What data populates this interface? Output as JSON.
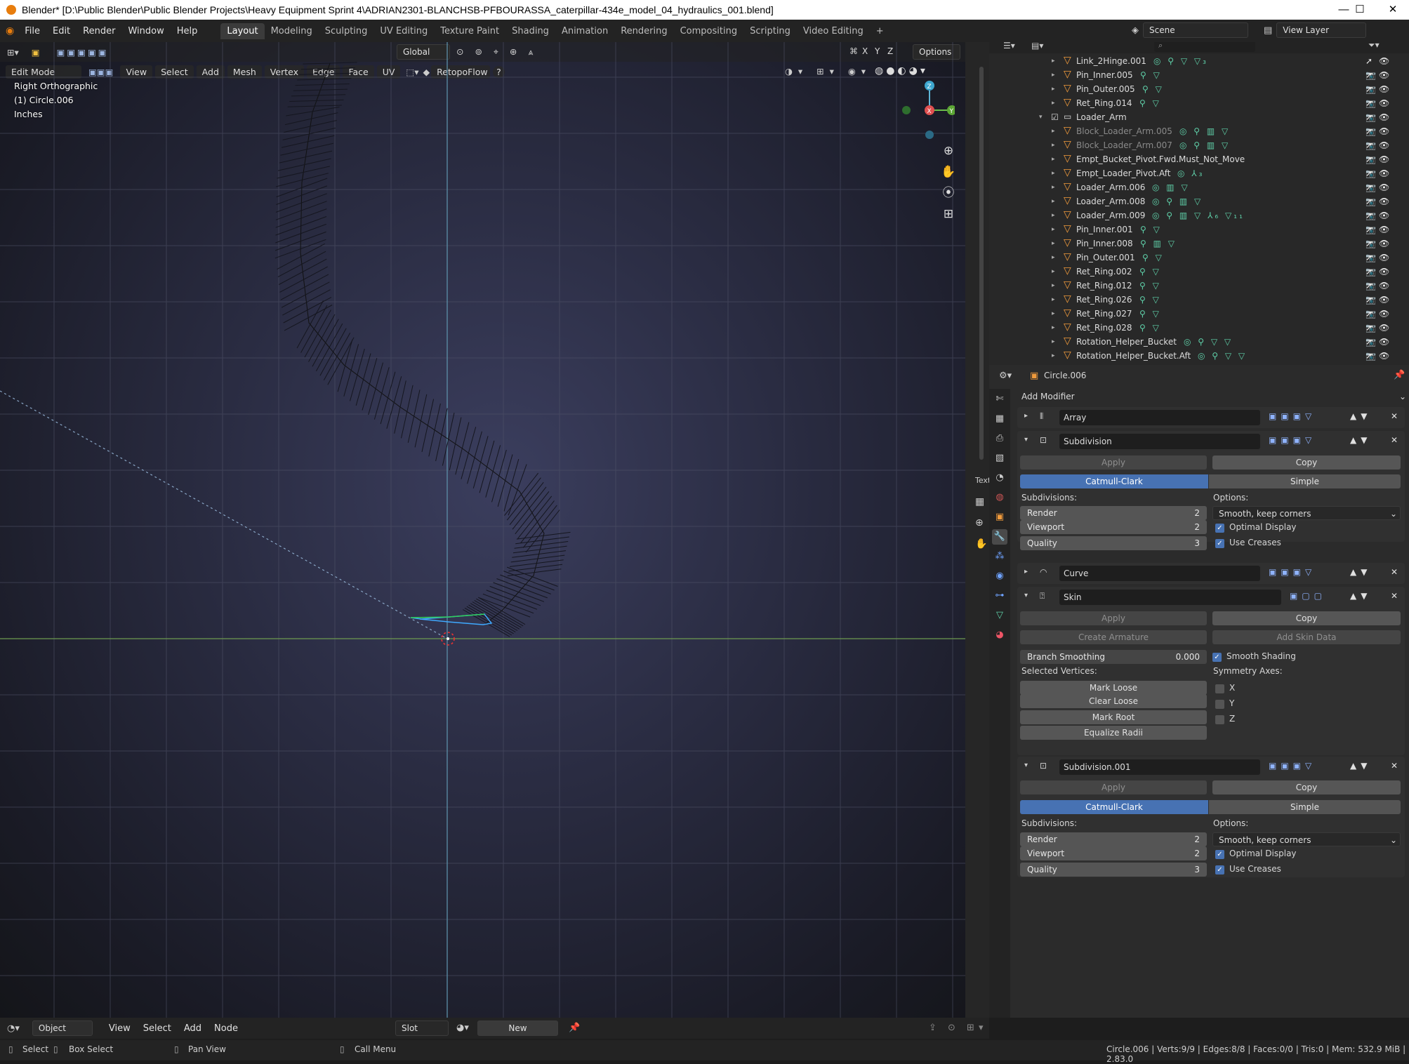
{
  "window": {
    "title": "Blender* [D:\\Public Blender\\Public Blender Projects\\Heavy Equipment Sprint 4\\ADRIAN2301-BLANCHSB-PFBOURASSA_caterpillar-434e_model_04_hydraulics_001.blend]",
    "minimize": "—",
    "maximize": "☐",
    "close": "✕"
  },
  "menus": [
    "File",
    "Edit",
    "Render",
    "Window",
    "Help"
  ],
  "workspaces": [
    "Layout",
    "Modeling",
    "Sculpting",
    "UV Editing",
    "Texture Paint",
    "Shading",
    "Animation",
    "Rendering",
    "Compositing",
    "Scripting",
    "Video Editing"
  ],
  "add_workspace": "+",
  "scene": {
    "value": "Scene",
    "view_layer": "View Layer"
  },
  "viewport_header": {
    "transform_orientation": "Global",
    "options": "Options",
    "axes": [
      "X",
      "Y",
      "Z"
    ],
    "mode": "Edit Mode",
    "menus": [
      "View",
      "Select",
      "Add",
      "Mesh",
      "Vertex",
      "Edge",
      "Face",
      "UV"
    ],
    "addon": "RetopoFlow",
    "help": "?"
  },
  "viewport_overlay": {
    "view": "Right Orthographic",
    "object": "(1) Circle.006",
    "units": "Inches"
  },
  "gizmo": {
    "x": "X",
    "y": "Y",
    "z": "Z"
  },
  "side_tab": "Text",
  "outliner": {
    "search_placeholder": "",
    "rows": [
      {
        "name": "Link_2Hinge.001",
        "icons": "◎ ⚲ ▽ ▽₃",
        "dim": false
      },
      {
        "name": "Pin_Inner.005",
        "icons": "⚲ ▽",
        "dim": false
      },
      {
        "name": "Pin_Outer.005",
        "icons": "⚲ ▽",
        "dim": false
      },
      {
        "name": "Ret_Ring.014",
        "icons": "⚲ ▽",
        "dim": false
      },
      {
        "name": "Loader_Arm",
        "icons": "",
        "dim": false,
        "collection": true
      },
      {
        "name": "Block_Loader_Arm.005",
        "icons": "◎ ⚲ ▥ ▽",
        "dim": true
      },
      {
        "name": "Block_Loader_Arm.007",
        "icons": "◎ ⚲ ▥ ▽",
        "dim": true
      },
      {
        "name": "Empt_Bucket_Pivot.Fwd.Must_Not_Move",
        "icons": "",
        "dim": false
      },
      {
        "name": "Empt_Loader_Pivot.Aft",
        "icons": "◎ ⅄₃",
        "dim": false
      },
      {
        "name": "Loader_Arm.006",
        "icons": "◎ ▥ ▽",
        "dim": false
      },
      {
        "name": "Loader_Arm.008",
        "icons": "◎ ⚲ ▥ ▽",
        "dim": false
      },
      {
        "name": "Loader_Arm.009",
        "icons": "◎ ⚲ ▥ ▽ ⅄₆ ▽₁₁",
        "dim": false
      },
      {
        "name": "Pin_Inner.001",
        "icons": "⚲ ▽",
        "dim": false
      },
      {
        "name": "Pin_Inner.008",
        "icons": "⚲ ▥ ▽",
        "dim": false
      },
      {
        "name": "Pin_Outer.001",
        "icons": "⚲ ▽",
        "dim": false
      },
      {
        "name": "Ret_Ring.002",
        "icons": "⚲ ▽",
        "dim": false
      },
      {
        "name": "Ret_Ring.012",
        "icons": "⚲ ▽",
        "dim": false
      },
      {
        "name": "Ret_Ring.026",
        "icons": "⚲ ▽",
        "dim": false
      },
      {
        "name": "Ret_Ring.027",
        "icons": "⚲ ▽",
        "dim": false
      },
      {
        "name": "Ret_Ring.028",
        "icons": "⚲ ▽",
        "dim": false
      },
      {
        "name": "Rotation_Helper_Bucket",
        "icons": "◎ ⚲ ▽ ▽",
        "dim": false
      },
      {
        "name": "Rotation_Helper_Bucket.Aft",
        "icons": "◎ ⚲ ▽ ▽",
        "dim": false
      }
    ]
  },
  "properties": {
    "object": "Circle.006",
    "add_modifier": "Add Modifier",
    "array": {
      "name": "Array"
    },
    "subdivision": {
      "name": "Subdivision",
      "apply": "Apply",
      "copy": "Copy",
      "catmull": "Catmull-Clark",
      "simple": "Simple",
      "subdivisions": "Subdivisions:",
      "options": "Options:",
      "render_label": "Render",
      "render": "2",
      "viewport_label": "Viewport",
      "viewport": "2",
      "quality_label": "Quality",
      "quality": "3",
      "uv_smooth": "Smooth, keep corners",
      "optimal": "Optimal Display",
      "creases": "Use Creases"
    },
    "curve": {
      "name": "Curve"
    },
    "skin": {
      "name": "Skin",
      "apply": "Apply",
      "copy": "Copy",
      "create_armature": "Create Armature",
      "add_skin_data": "Add Skin Data",
      "branch_label": "Branch Smoothing",
      "branch": "0.000",
      "smooth_shading": "Smooth Shading",
      "selected_vertices": "Selected Vertices:",
      "symmetry_axes": "Symmetry Axes:",
      "mark_loose": "Mark Loose",
      "clear_loose": "Clear Loose",
      "mark_root": "Mark Root",
      "equalize": "Equalize Radii",
      "x": "X",
      "y": "Y",
      "z": "Z"
    },
    "subdivision2": {
      "name": "Subdivision.001",
      "apply": "Apply",
      "copy": "Copy",
      "catmull": "Catmull-Clark",
      "simple": "Simple",
      "subdivisions": "Subdivisions:",
      "options": "Options:",
      "render_label": "Render",
      "render": "2",
      "viewport_label": "Viewport",
      "viewport": "2",
      "quality_label": "Quality",
      "quality": "3",
      "uv_smooth": "Smooth, keep corners",
      "optimal": "Optimal Display",
      "creases": "Use Creases"
    }
  },
  "bottom_header": {
    "mode": "Object",
    "menus": [
      "View",
      "Select",
      "Add",
      "Node"
    ],
    "slot": "Slot",
    "new": "New"
  },
  "statusbar": {
    "select": "Select",
    "box_select": "Box Select",
    "pan_view": "Pan View",
    "call_menu": "Call Menu",
    "stats": "Circle.006 | Verts:9/9 | Edges:8/8 | Faces:0/0 | Tris:0 | Mem: 532.9 MiB | 2.83.0"
  }
}
